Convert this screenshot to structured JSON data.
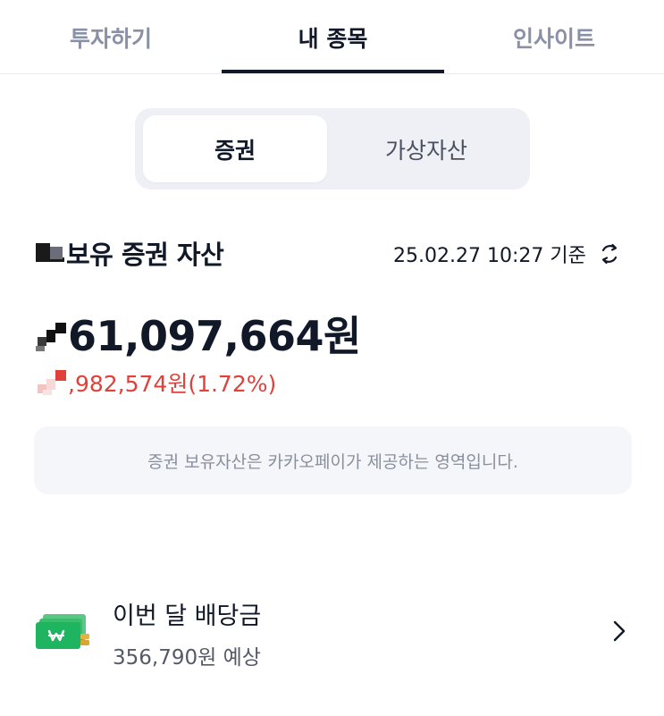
{
  "tabs": [
    {
      "label": "투자하기"
    },
    {
      "label": "내 종목"
    },
    {
      "label": "인사이트"
    }
  ],
  "segment": {
    "options": [
      "증권",
      "가상자산"
    ],
    "selected": "증권"
  },
  "holdings": {
    "title": "보유 증권 자산",
    "timestamp": "25.02.27 10:27 기준",
    "total": "61,097,664원",
    "change": ",982,574원(1.72%)"
  },
  "notice": {
    "text": "증권 보유자산은 카카오페이가 제공하는 영역입니다."
  },
  "dividend": {
    "title": "이번 달 배당금",
    "subtitle": "356,790원 예상"
  },
  "colors": {
    "text": "#111827",
    "muted": "#8a90a6",
    "loss_red": "#e0413a",
    "segment_bg": "#eef0f6",
    "notice_bg": "#f5f6fa",
    "money_green": "#1fb45f"
  },
  "icons": [
    "refresh-icon",
    "money-stack-icon",
    "chevron-right-icon"
  ]
}
